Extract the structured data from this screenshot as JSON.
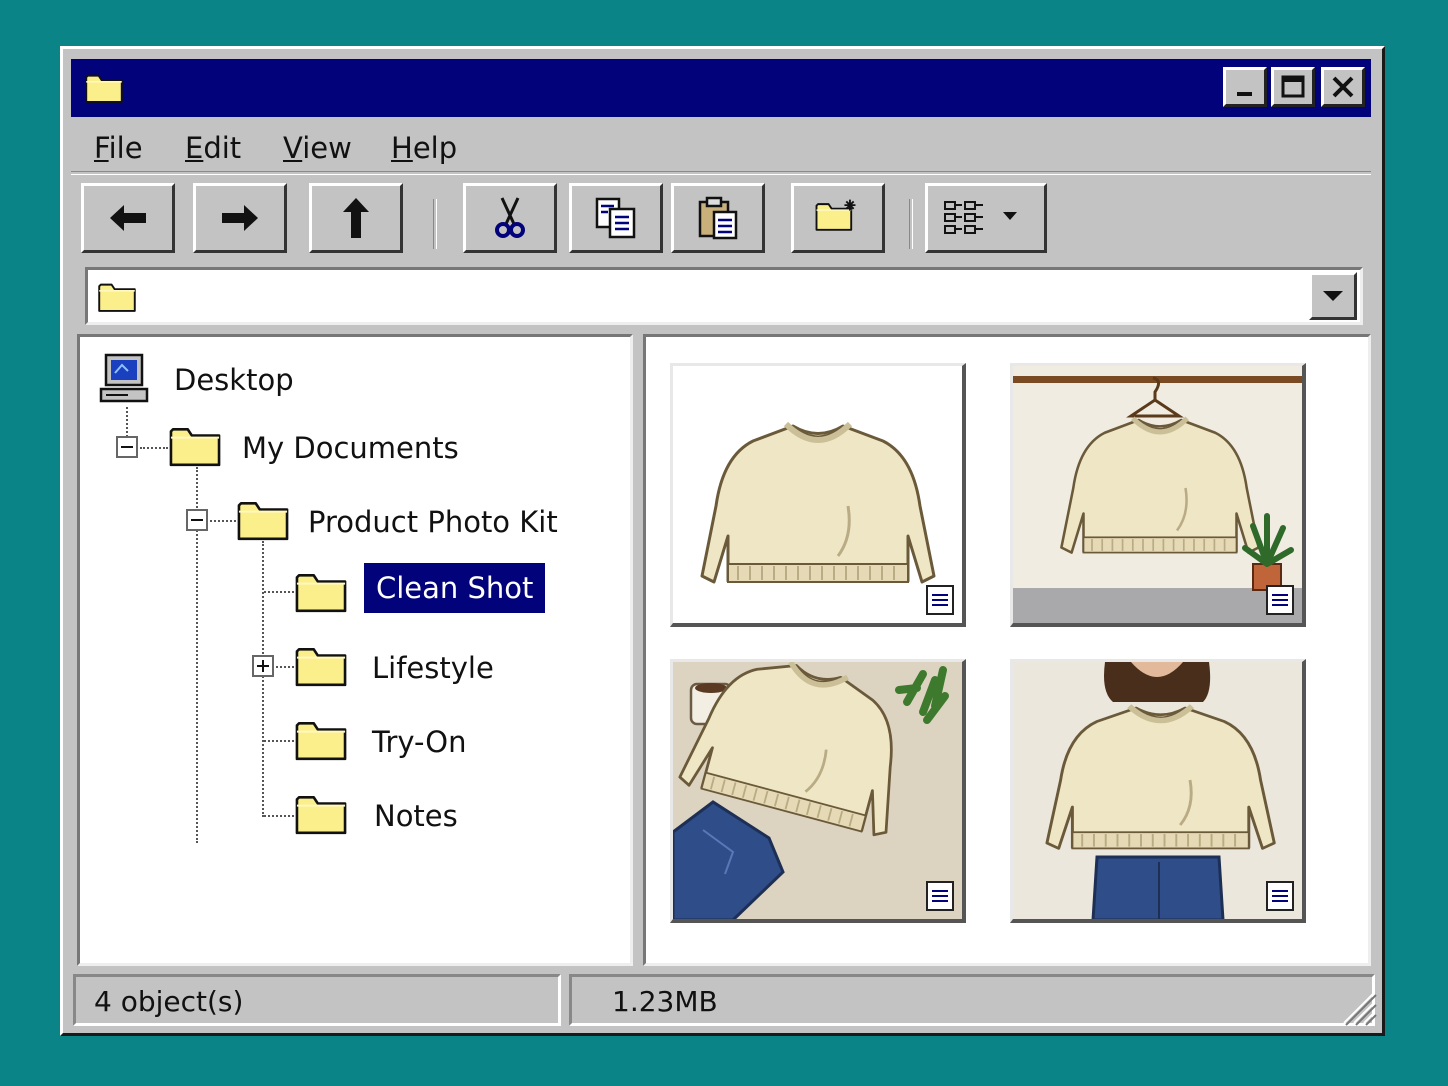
{
  "window": {
    "title": ""
  },
  "menu": [
    {
      "label": "File",
      "key": "F",
      "rest": "ile"
    },
    {
      "label": "Edit",
      "key": "E",
      "rest": "dit"
    },
    {
      "label": "View",
      "key": "V",
      "rest": "iew"
    },
    {
      "label": "Help",
      "key": "H",
      "rest": "elp"
    }
  ],
  "toolbar": [
    "back-icon",
    "forward-icon",
    "up-icon",
    "cut-icon",
    "copy-icon",
    "paste-icon",
    "new-folder-icon",
    "view-menu-icon"
  ],
  "address": {
    "value": ""
  },
  "tree": {
    "desktop": "Desktop",
    "my_documents": "My Documents",
    "product_photo_kit": "Product Photo Kit",
    "clean_shot": "Clean Shot",
    "lifestyle": "Lifestyle",
    "try_on": "Try-On",
    "notes": "Notes"
  },
  "thumbnails": [
    "sweater-plain",
    "sweater-on-hanger",
    "sweater-flatlay",
    "sweater-worn"
  ],
  "status": {
    "objects": "4 object(s)",
    "size": "1.23MB"
  },
  "colors": {
    "desktop": "#0b8487",
    "titlebar": "#02037a",
    "chrome": "#c3c3c3",
    "folder": "#fbef8c",
    "sweater": "#efe6c6"
  }
}
